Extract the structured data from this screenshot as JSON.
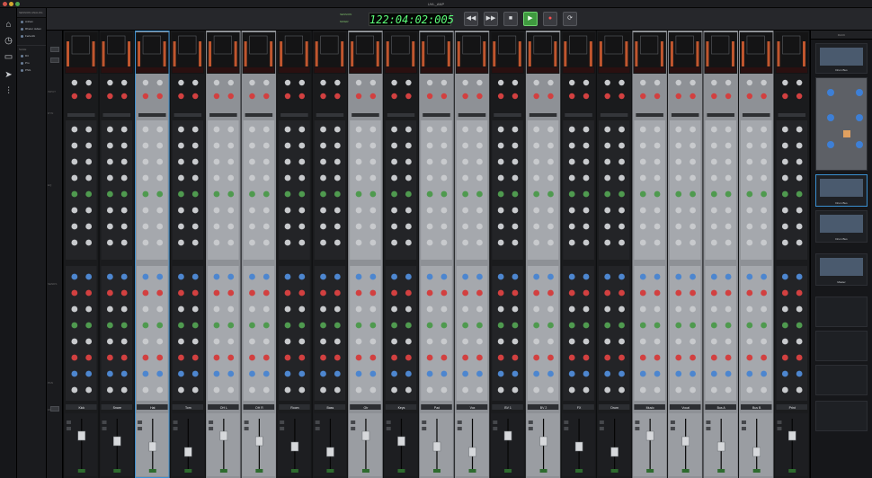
{
  "window": {
    "title": "UVL_ANP"
  },
  "sessions": {
    "header": "SESSION ANALOG",
    "items": [
      {
        "label": "Anhan"
      },
      {
        "label": "Rhetur Jeben"
      },
      {
        "label": "Fertenbi"
      }
    ],
    "sub_header": "SAGE",
    "sub_items": [
      {
        "label": "Drt"
      },
      {
        "label": "Pro"
      },
      {
        "label": "PSG"
      }
    ]
  },
  "transport": {
    "indicators": [
      "SESSION",
      "MIXER"
    ],
    "counter": "122:04:02:005",
    "buttons": [
      "rewind",
      "fast-forward",
      "stop",
      "play",
      "record",
      "loop"
    ]
  },
  "colors": {
    "accent_green": "#5cff7a",
    "play_green": "#3f9a3f",
    "record_red": "#ff5050",
    "selected_blue": "#3a8fd0"
  },
  "console": {
    "side_labels": [
      "INPUT",
      "DYN",
      "EQ",
      "SENDS",
      "PAN",
      "FADER"
    ],
    "channels": [
      {
        "name": "Kick",
        "panel": "dark"
      },
      {
        "name": "Snare",
        "panel": "dark"
      },
      {
        "name": "Hat",
        "panel": "light"
      },
      {
        "name": "Tom",
        "panel": "dark"
      },
      {
        "name": "OH L",
        "panel": "light"
      },
      {
        "name": "OH R",
        "panel": "light"
      },
      {
        "name": "Room",
        "panel": "dark"
      },
      {
        "name": "Bass",
        "panel": "dark"
      },
      {
        "name": "Gtr",
        "panel": "light"
      },
      {
        "name": "Keys",
        "panel": "dark"
      },
      {
        "name": "Pad",
        "panel": "light"
      },
      {
        "name": "Vox",
        "panel": "light"
      },
      {
        "name": "BV 1",
        "panel": "dark"
      },
      {
        "name": "BV 2",
        "panel": "light"
      },
      {
        "name": "FX",
        "panel": "dark"
      },
      {
        "name": "Drum",
        "panel": "dark"
      },
      {
        "name": "Music",
        "panel": "light"
      },
      {
        "name": "Vocal",
        "panel": "light"
      },
      {
        "name": "Bus A",
        "panel": "light"
      },
      {
        "name": "Bus B",
        "panel": "light"
      },
      {
        "name": "Print",
        "panel": "dark"
      }
    ]
  },
  "rack": {
    "header": "RACK",
    "slots": [
      {
        "label": "Drum Bus"
      },
      {
        "label": ""
      },
      {
        "label": "Drum Bus"
      },
      {
        "label": "Drum Bus"
      },
      {
        "label": "Master"
      },
      {
        "label": ""
      },
      {
        "label": ""
      },
      {
        "label": ""
      },
      {
        "label": ""
      }
    ]
  }
}
